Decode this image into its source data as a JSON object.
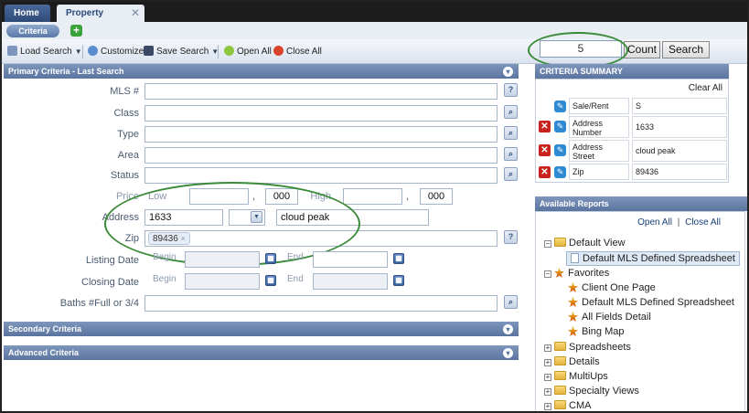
{
  "tabs": {
    "home": "Home",
    "property_history": "Property History",
    "close_glyph": "✕"
  },
  "subbar": {
    "criteria": "Criteria",
    "add": "+"
  },
  "toolbar": {
    "load_search": "Load Search",
    "customize": "Customize",
    "save_search": "Save Search",
    "open_all": "Open All",
    "close_all": "Close All",
    "count_value": "5",
    "count_btn": "Count",
    "search_btn": "Search"
  },
  "primary": {
    "title": "Primary Criteria - Last Search",
    "mls": "MLS #",
    "class": "Class",
    "type": "Type",
    "area": "Area",
    "status": "Status",
    "price": "Price",
    "low": "Low",
    "high": "High",
    "price_low_suffix": "000",
    "price_high_suffix": "000",
    "comma": ",",
    "address": "Address",
    "address_number": "1633",
    "address_street": "cloud peak",
    "zip": "Zip",
    "zip_chip": "89436",
    "chip_x": "×",
    "listing_date": "Listing Date",
    "closing_date": "Closing Date",
    "begin": "Begin",
    "end": "End",
    "baths": "Baths #Full or 3/4"
  },
  "secondary": {
    "title": "Secondary Criteria"
  },
  "advanced": {
    "title": "Advanced Criteria"
  },
  "summary": {
    "title": "CRITERIA SUMMARY",
    "clear_all": "Clear All",
    "rows": [
      {
        "label": "Sale/Rent",
        "value": "S"
      },
      {
        "label": "Address Number",
        "value": "1633"
      },
      {
        "label": "Address Street",
        "value": "cloud peak"
      },
      {
        "label": "Zip",
        "value": "89436"
      }
    ]
  },
  "reports": {
    "title": "Available Reports",
    "open_all": "Open All",
    "divider": "|",
    "close_all": "Close All",
    "default_view": "Default View",
    "default_mls": "Default MLS Defined Spreadsheet",
    "favorites": "Favorites",
    "fav_items": [
      "Client One Page",
      "Default MLS Defined Spreadsheet",
      "All Fields Detail",
      "Bing Map"
    ],
    "folders": [
      "Spreadsheets",
      "Details",
      "MultiUps",
      "Specialty Views",
      "CMA"
    ],
    "toggle_open": "−",
    "toggle_closed": "+"
  },
  "icons": {
    "magnifier": "⌕",
    "help": "?",
    "calendar": "▦",
    "dropdown": "▼",
    "collapse": "▾"
  },
  "colors": {
    "ring": "#3a8a3a",
    "header": "#5a74a0",
    "remove": "#c8231f",
    "edit": "#2f8ad4"
  }
}
